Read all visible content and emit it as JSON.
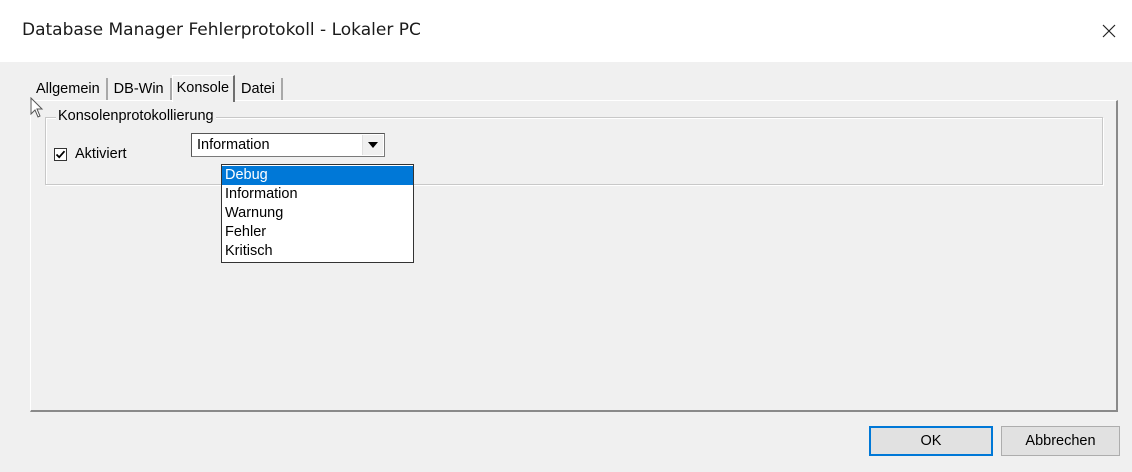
{
  "window": {
    "title": "Database Manager Fehlerprotokoll - Lokaler PC",
    "close_icon": "close-icon"
  },
  "tabs": [
    {
      "label": "Allgemein",
      "active": false
    },
    {
      "label": "DB-Win",
      "active": false
    },
    {
      "label": "Konsole",
      "active": true
    },
    {
      "label": "Datei",
      "active": false
    }
  ],
  "console": {
    "group_label": "Konsolenprotokollierung",
    "enabled_label": "Aktiviert",
    "enabled": true,
    "level_selected": "Information",
    "level_options": [
      "Debug",
      "Information",
      "Warnung",
      "Fehler",
      "Kritisch"
    ],
    "highlighted_option": "Debug"
  },
  "buttons": {
    "ok": "OK",
    "cancel": "Abbrechen"
  },
  "colors": {
    "highlight": "#0078d7",
    "window_bg": "#f0f0f0"
  }
}
